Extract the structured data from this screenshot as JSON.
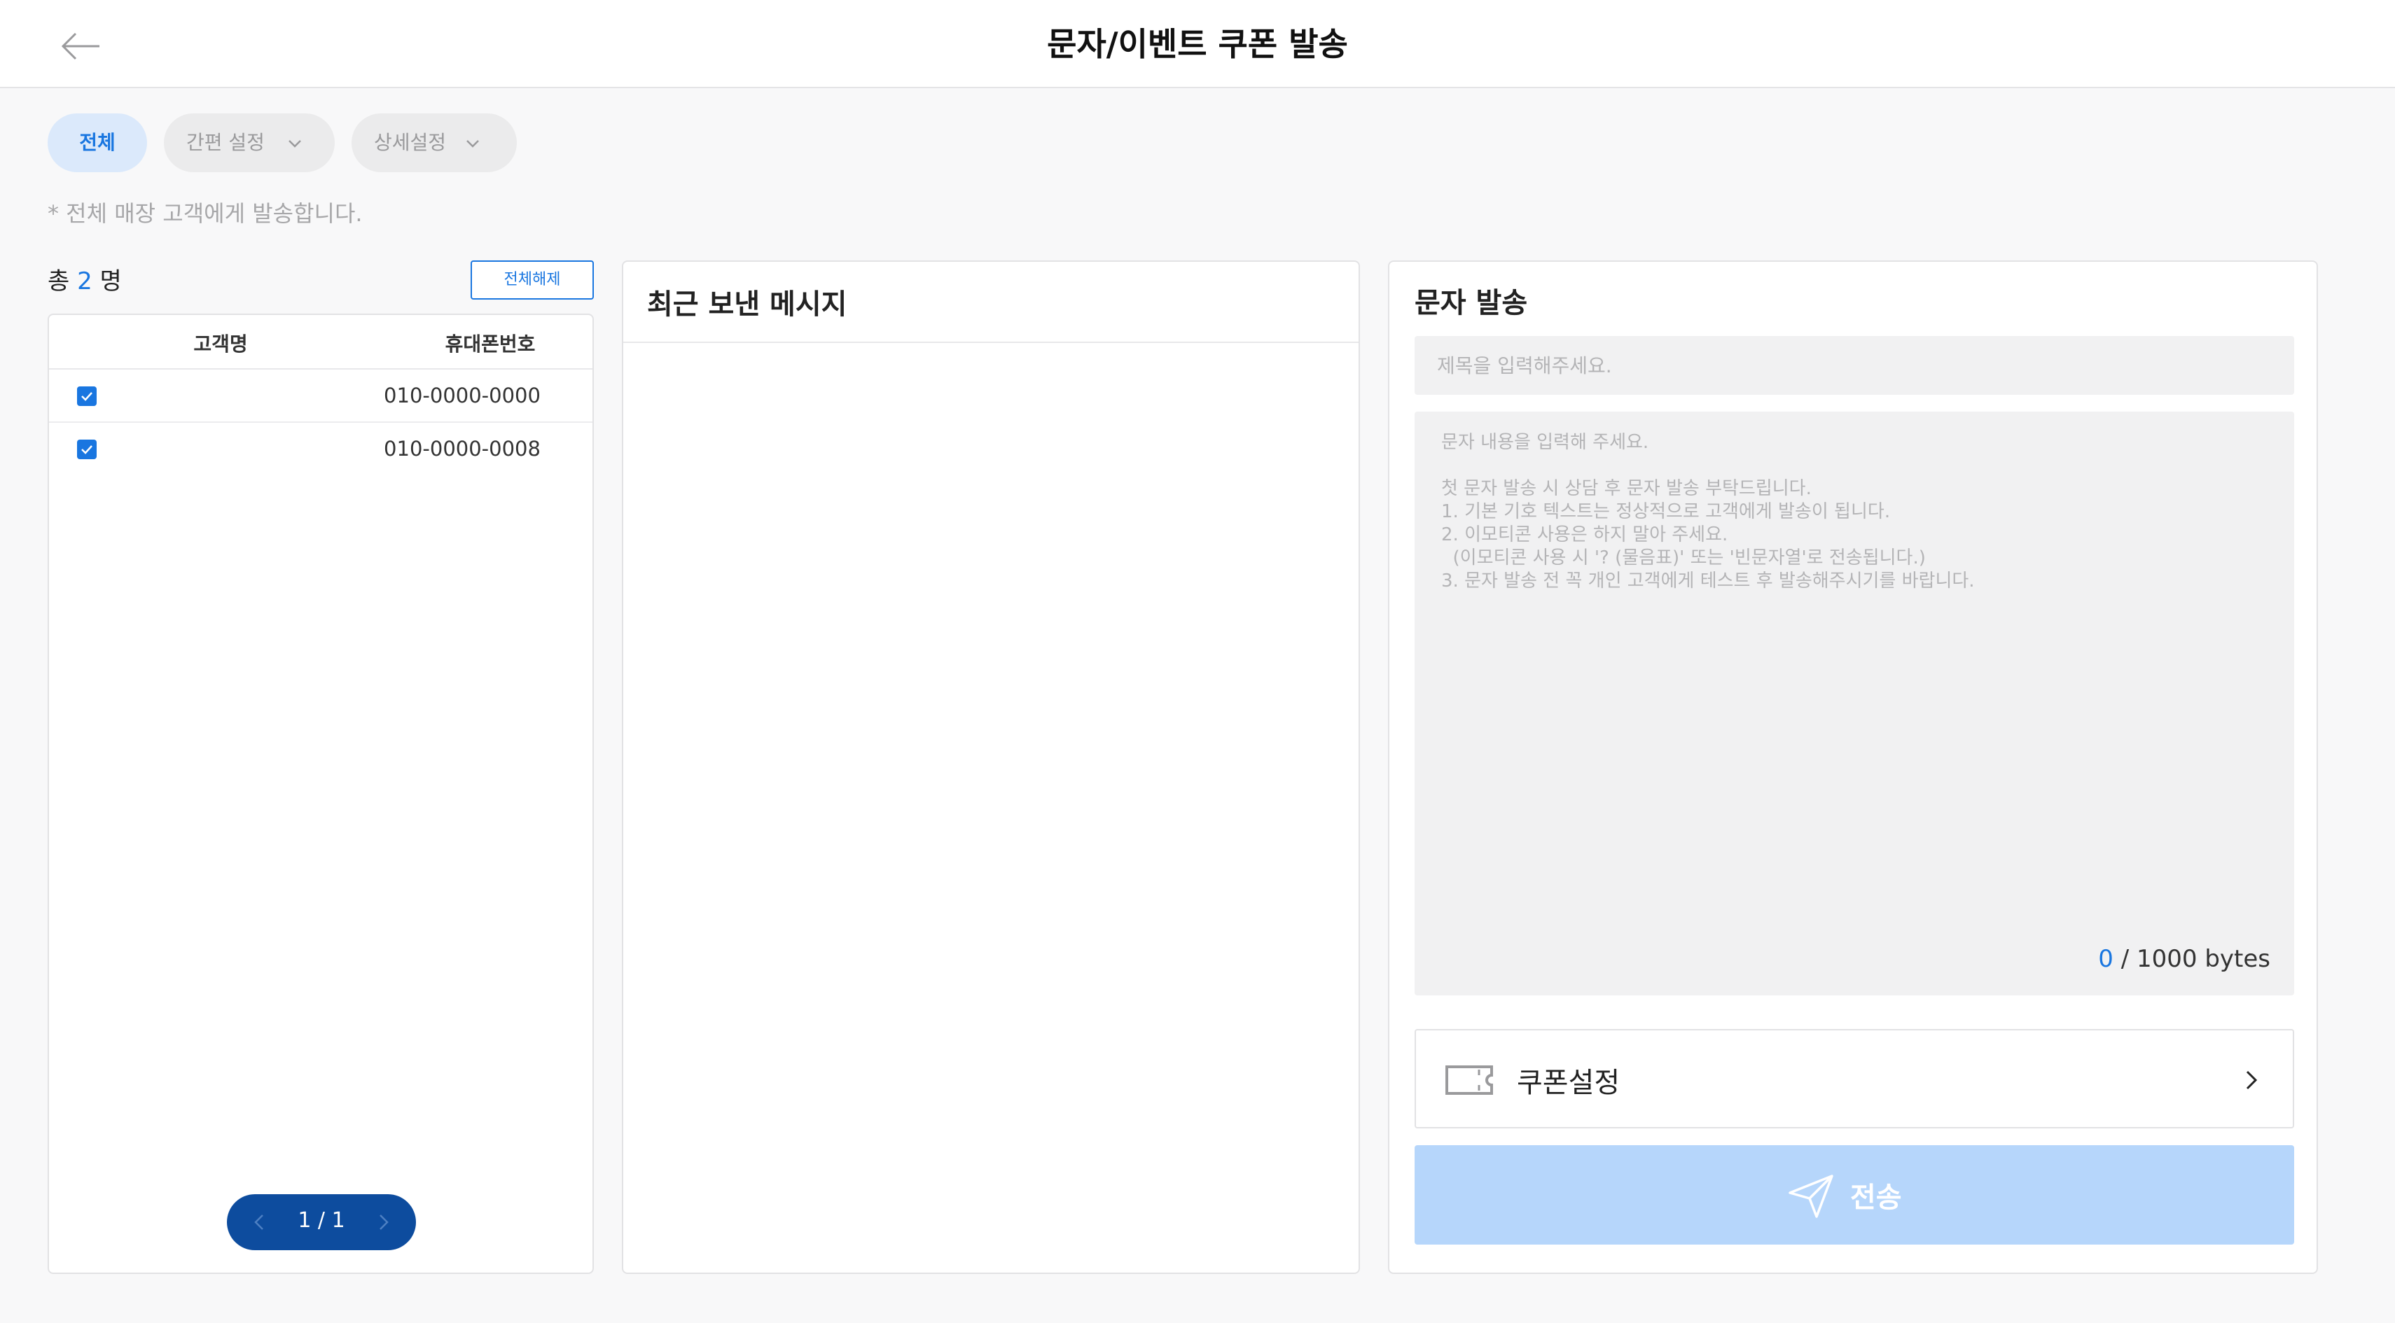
{
  "header": {
    "title": "문자/이벤트 쿠폰 발송",
    "back_icon": "arrow-left-icon"
  },
  "filters": {
    "tabs": [
      {
        "label": "전체",
        "active": true
      },
      {
        "label": "간편 설정",
        "active": false,
        "icon": "chevron-down-icon"
      },
      {
        "label": "상세설정",
        "active": false,
        "icon": "chevron-down-icon"
      }
    ],
    "notice": "* 전체 매장 고객에게 발송합니다."
  },
  "recipients": {
    "total_prefix": "총",
    "total_count": "2",
    "total_suffix": "명",
    "clear_all_label": "전체해제",
    "columns": [
      "고객명",
      "휴대폰번호"
    ],
    "rows": [
      {
        "name": "",
        "phone": "010-0000-0000",
        "checked": true
      },
      {
        "name": "",
        "phone": "010-0000-0008",
        "checked": true
      }
    ],
    "pagination": {
      "label": "1 / 1",
      "current": 1,
      "total": 1
    }
  },
  "recent": {
    "title": "최근 보낸 메시지"
  },
  "sms": {
    "title": "문자 발송",
    "subject_placeholder": "제목을 입력해주세요.",
    "body_placeholder": "문자 내용을 입력해 주세요.\n\n첫 문자 발송 시 상담 후 문자 발송 부탁드립니다.\n1. 기본 기호 텍스트는 정상적으로 고객에게 발송이 됩니다.\n2. 이모티콘 사용은 하지 말아 주세요.\n  (이모티콘 사용 시 '? (물음표)' 또는 '빈문자열'로 전송됩니다.)\n3. 문자 발송 전 꼭 개인 고객에게 테스트 후 발송해주시기를 바랍니다.",
    "byte_count": "0",
    "byte_limit": "/ 1000 bytes",
    "coupon_label": "쿠폰설정",
    "send_label": "전송"
  },
  "colors": {
    "accent": "#1976e0",
    "pager_bg": "#0d4c9e",
    "send_disabled": "#b6d6fb",
    "input_bg": "#f1f1f2"
  }
}
